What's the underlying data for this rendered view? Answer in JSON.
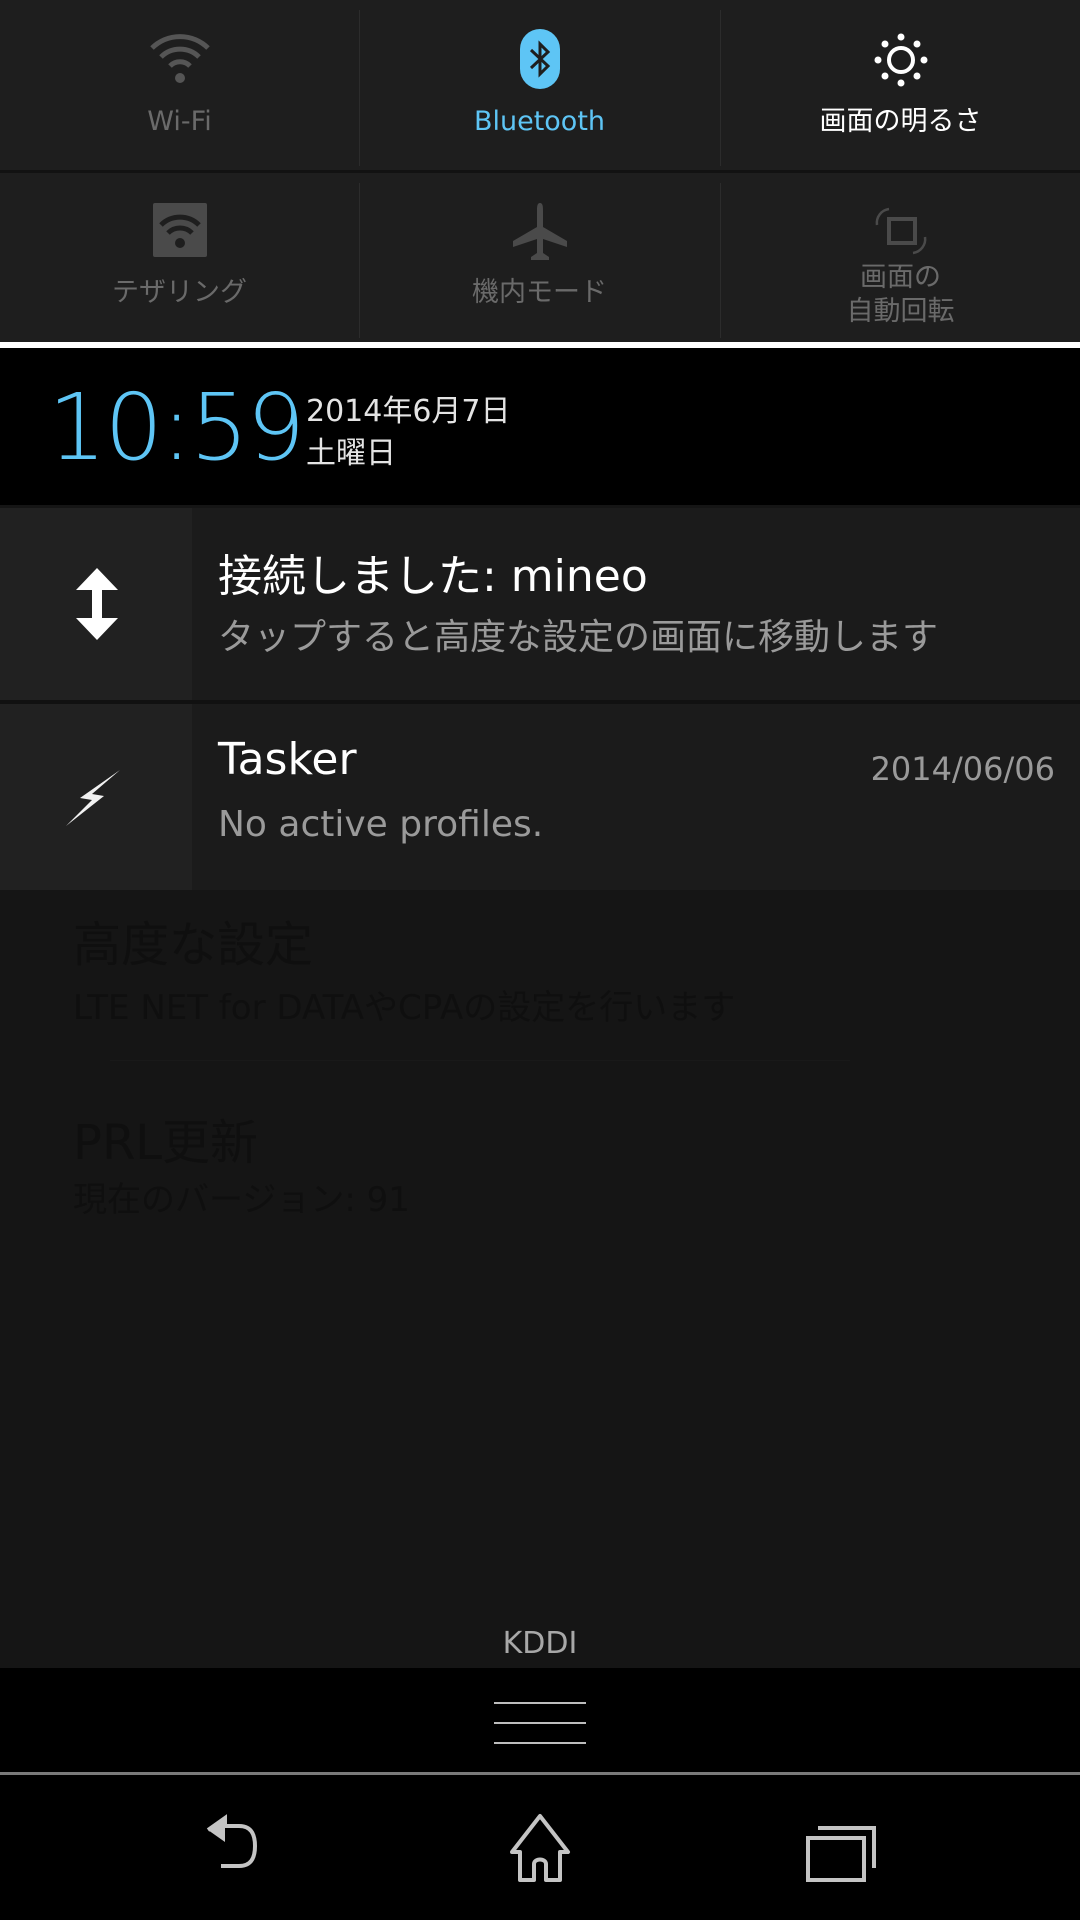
{
  "quick_settings": {
    "tiles": [
      {
        "label": "Wi-Fi",
        "icon": "wifi-icon",
        "state": "off",
        "color": "#6a6a6a"
      },
      {
        "label": "Bluetooth",
        "icon": "bluetooth-icon",
        "state": "on",
        "color": "#5ec5f5"
      },
      {
        "label": "画面の明るさ",
        "icon": "brightness-icon",
        "state": "neutral",
        "color": "#ffffff"
      },
      {
        "label": "テザリング",
        "icon": "tethering-icon",
        "state": "off",
        "color": "#6a6a6a"
      },
      {
        "label": "機内モード",
        "icon": "airplane-icon",
        "state": "off",
        "color": "#6a6a6a"
      },
      {
        "label_line1": "画面の",
        "label_line2": "自動回転",
        "icon": "auto-rotate-icon",
        "state": "off",
        "color": "#6a6a6a"
      }
    ]
  },
  "header": {
    "time": "10:59",
    "date": "2014年6月7日",
    "weekday": "土曜日",
    "time_color": "#5ec5f5"
  },
  "notifications": [
    {
      "icon": "data-transfer-icon",
      "title": "接続しました: mineo",
      "text": "タップすると高度な設定の画面に移動します"
    },
    {
      "icon": "tasker-bolt-icon",
      "title": "Tasker",
      "time": "2014/06/06",
      "text": "No active profiles."
    }
  ],
  "background_app": {
    "items": [
      {
        "title": "高度な設定",
        "summary": "LTE NET for DATAやCPAの設定を行います"
      },
      {
        "title": "PRL更新",
        "summary": "現在のバージョン: 91"
      }
    ]
  },
  "carrier": "KDDI",
  "nav": {
    "back": "back-icon",
    "home": "home-icon",
    "recents": "recents-icon"
  }
}
